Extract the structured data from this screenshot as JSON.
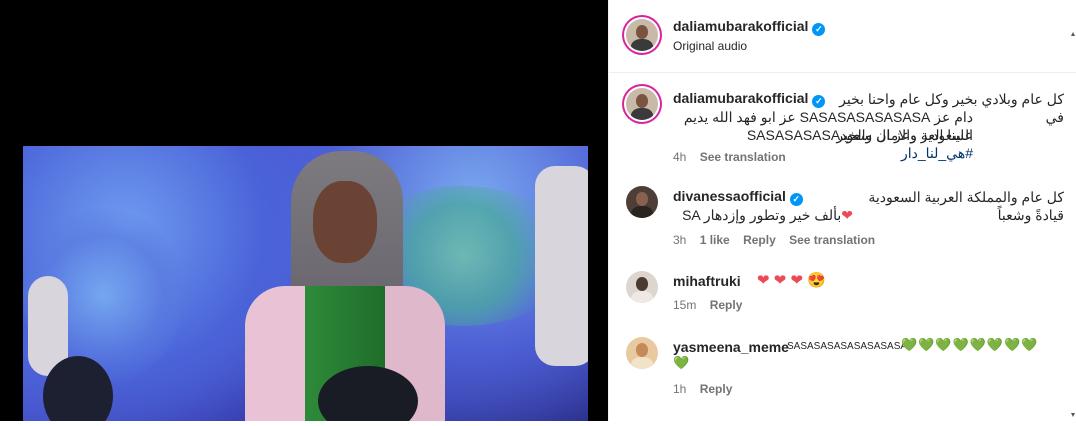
{
  "post": {
    "author": "daliamubarakofficial",
    "audio": "Original audio",
    "caption_line1": "كل عام وبلادي بخير وكل عام واحنا بخير في",
    "caption_line2": "دام عز SASASASASASASA عز ابو فهد الله يديم علينا العز والامان والخير",
    "caption_line3_text": "SASASASASAالسعودية وعز ال سعود",
    "caption_hashtag": "#هي_لنا_دار",
    "time": "4h",
    "see_translation": "See translation"
  },
  "comments": [
    {
      "user": "divanessaofficial",
      "verified": true,
      "line1": "كل عام والمملكة العربية السعودية قيادةً وشعباً",
      "line2": "SA بألف خير وتطور وإزدهار",
      "line2_emoji": "❤",
      "time": "3h",
      "likes": "1 like",
      "reply": "Reply",
      "see_translation": "See translation"
    },
    {
      "user": "mihaftruki",
      "emojis": "❤ ❤ ❤ 😍",
      "time": "15m",
      "reply": "Reply"
    },
    {
      "user": "yasmeena_meme",
      "text": "SASASASASASASASASA",
      "emojis": "💚💚💚💚💚💚💚💚",
      "emojis_line2": "💚",
      "time": "1h",
      "reply": "Reply"
    }
  ],
  "colors": {
    "accent": "#0095f6",
    "heart": "#ed4956",
    "muted": "#737373"
  }
}
